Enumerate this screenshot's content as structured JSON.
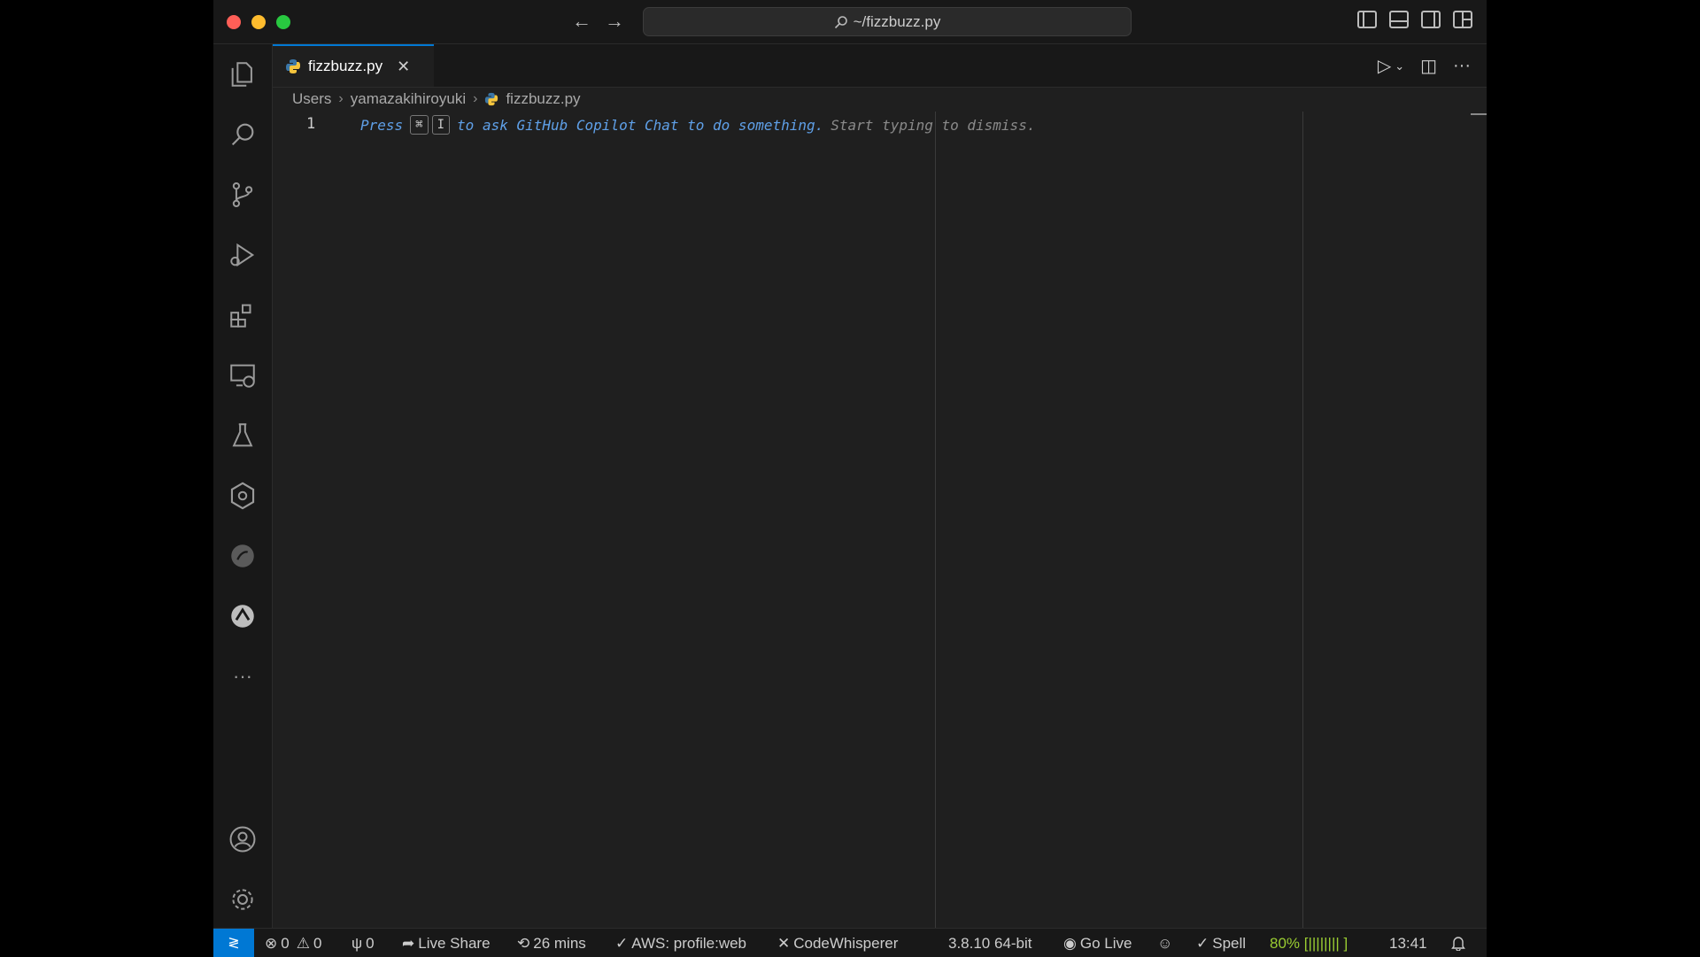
{
  "titlebar": {
    "search_text": "~/fizzbuzz.py",
    "back_icon": "arrow-left",
    "forward_icon": "arrow-right"
  },
  "activity_bar": {
    "items": [
      "explorer",
      "search",
      "source-control",
      "run-and-debug",
      "extensions",
      "remote-explorer",
      "testing",
      "kubernetes",
      "copilot",
      "live-share-activity",
      "more"
    ],
    "bottom": [
      "accounts",
      "manage"
    ],
    "more_glyph": "···"
  },
  "tab": {
    "label": "fizzbuzz.py",
    "close_glyph": "✕"
  },
  "breadcrumb": {
    "items": [
      "Users",
      "yamazakihiroyuki",
      "fizzbuzz.py"
    ],
    "separator": "›"
  },
  "editor": {
    "line_number": "1",
    "hint_press": "Press",
    "hint_key1": "⌘",
    "hint_key2": "I",
    "hint_text": "to ask GitHub Copilot Chat to do something.",
    "hint_dismiss": "Start typing to dismiss."
  },
  "statusbar": {
    "remote_glyph": "≷",
    "errors": "0",
    "warnings": "0",
    "ports": "0",
    "live_share": "Live Share",
    "time_tracker": "26 mins",
    "aws": "AWS: profile:web",
    "codewhisperer": "CodeWhisperer",
    "python_version": "3.8.10 64-bit",
    "go_live": "Go Live",
    "spell": "Spell",
    "battery": "80% [||||||||   ]",
    "clock": "13:41"
  },
  "colors": {
    "accent": "#0078d4",
    "hint_blue": "#5fa0e8",
    "battery_green": "#9acd32"
  }
}
